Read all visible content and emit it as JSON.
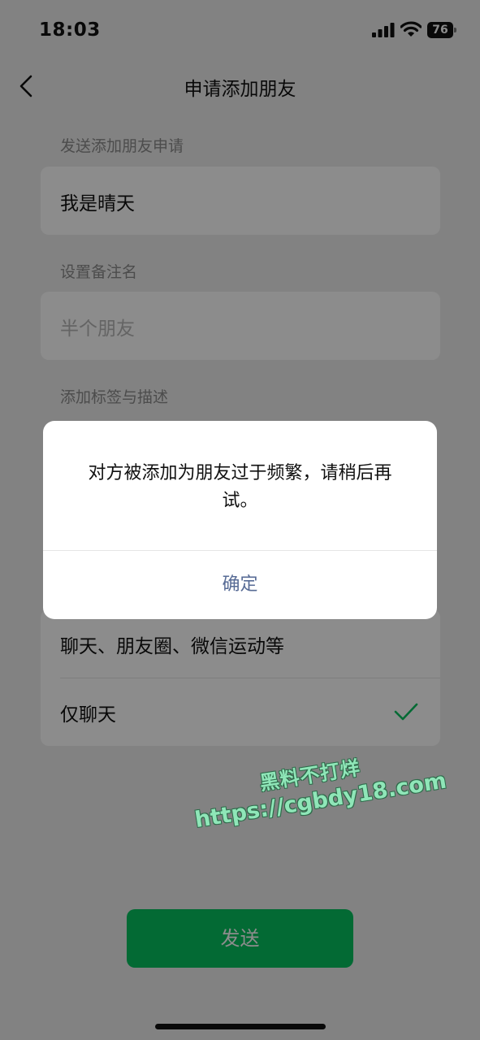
{
  "status_bar": {
    "time": "18:03",
    "battery": "76"
  },
  "nav": {
    "title": "申请添加朋友"
  },
  "form": {
    "request_label": "发送添加朋友申请",
    "request_value": "我是晴天",
    "remark_label": "设置备注名",
    "remark_placeholder": "半个朋友",
    "tags_label": "添加标签与描述"
  },
  "permissions": {
    "items": [
      {
        "label": "聊天、朋友圈、微信运动等",
        "selected": false
      },
      {
        "label": "仅聊天",
        "selected": true
      }
    ]
  },
  "send_button": {
    "label": "发送"
  },
  "dialog": {
    "message": "对方被添加为朋友过于频繁，请稍后再试。",
    "confirm_label": "确定"
  },
  "watermark": {
    "line1": "黑料不打烊",
    "line2": "https://cgbdy18.com"
  },
  "colors": {
    "accent": "#07c160",
    "link": "#576b95",
    "background": "#ededed"
  }
}
